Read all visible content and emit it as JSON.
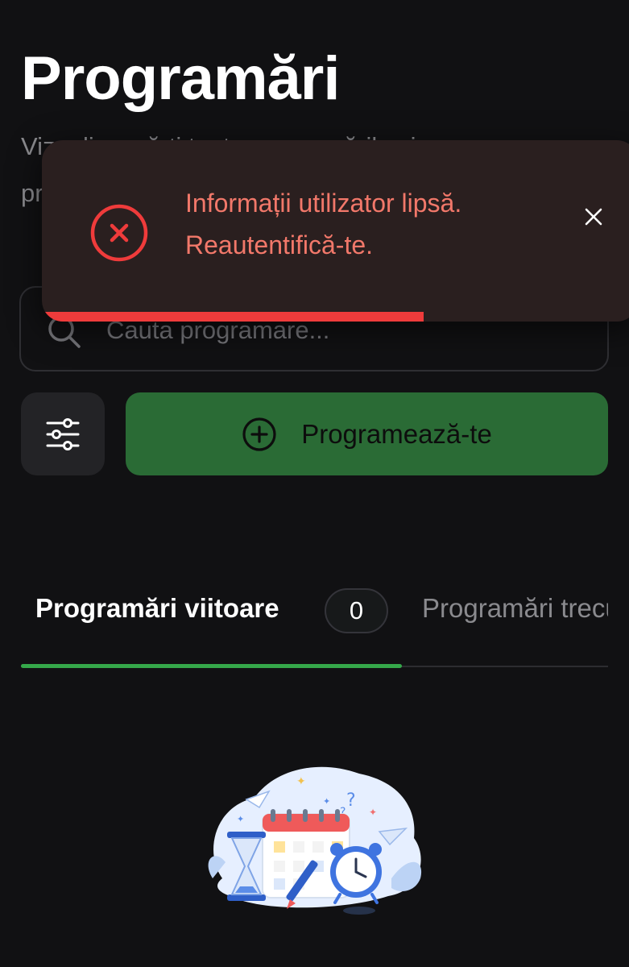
{
  "header": {
    "title": "Programări",
    "subtitle": "Vizualizează-ți toate programările și progresul"
  },
  "search": {
    "placeholder": "Cauta programare...",
    "value": ""
  },
  "actions": {
    "book_label": "Programează-te"
  },
  "tabs": [
    {
      "label": "Programări viitoare",
      "count": "0",
      "active": true
    },
    {
      "label": "Programări trecute",
      "active": false
    }
  ],
  "toast": {
    "type": "error",
    "line1": "Informații utilizator lipsă.",
    "line2": "Reautentifică-te.",
    "progress": 0.64
  },
  "colors": {
    "background": "#111113",
    "accent": "#35a84a",
    "primary_button": "#2a6b35",
    "error": "#ef3b3b",
    "toast_background": "#2a1f1f"
  },
  "icons": {
    "search": "search-icon",
    "filter": "sliders-icon",
    "book": "plus-circle-icon",
    "toast_status": "error-circle-icon",
    "toast_close": "close-icon",
    "empty_state": "calendar-clock-hourglass-illustration"
  }
}
